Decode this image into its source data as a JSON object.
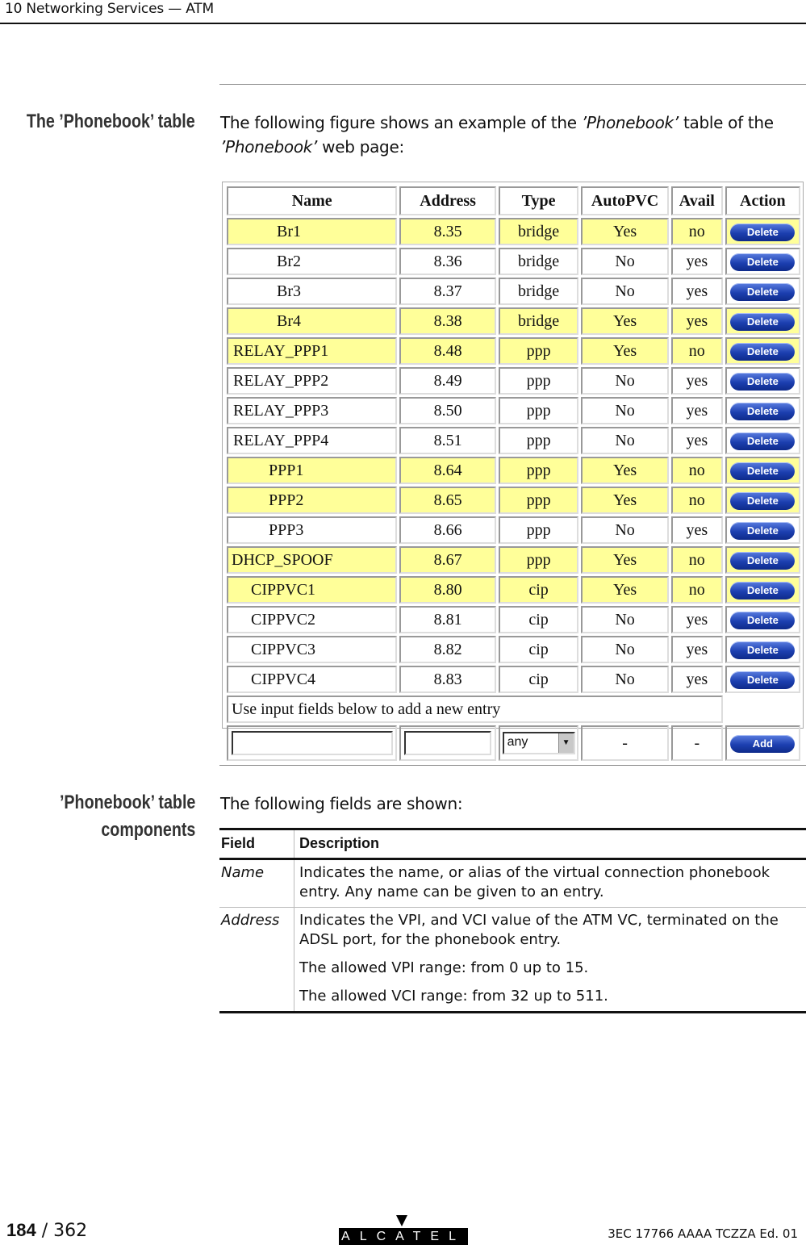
{
  "header": {
    "title": "10 Networking Services — ATM"
  },
  "section1": {
    "side_title": "The ’Phonebook’ table",
    "intro_pre": "The following figure shows an example of the ",
    "intro_em1": "’Phonebook’",
    "intro_mid": " table of the ",
    "intro_em2": "’Phonebook’",
    "intro_post": " web page:"
  },
  "phonebook": {
    "columns": [
      "Name",
      "Address",
      "Type",
      "AutoPVC",
      "Avail",
      "Action"
    ],
    "rows": [
      {
        "name": "Br1",
        "address": "8.35",
        "type": "bridge",
        "autopvc": "Yes",
        "avail": "no",
        "action": "Delete",
        "highlight": true,
        "indent": "br"
      },
      {
        "name": "Br2",
        "address": "8.36",
        "type": "bridge",
        "autopvc": "No",
        "avail": "yes",
        "action": "Delete",
        "highlight": false,
        "indent": "br"
      },
      {
        "name": "Br3",
        "address": "8.37",
        "type": "bridge",
        "autopvc": "No",
        "avail": "yes",
        "action": "Delete",
        "highlight": false,
        "indent": "br"
      },
      {
        "name": "Br4",
        "address": "8.38",
        "type": "bridge",
        "autopvc": "Yes",
        "avail": "yes",
        "action": "Delete",
        "highlight": true,
        "indent": "br"
      },
      {
        "name": "RELAY_PPP1",
        "address": "8.48",
        "type": "ppp",
        "autopvc": "Yes",
        "avail": "no",
        "action": "Delete",
        "highlight": true,
        "indent": "relay"
      },
      {
        "name": "RELAY_PPP2",
        "address": "8.49",
        "type": "ppp",
        "autopvc": "No",
        "avail": "yes",
        "action": "Delete",
        "highlight": false,
        "indent": "relay"
      },
      {
        "name": "RELAY_PPP3",
        "address": "8.50",
        "type": "ppp",
        "autopvc": "No",
        "avail": "yes",
        "action": "Delete",
        "highlight": false,
        "indent": "relay"
      },
      {
        "name": "RELAY_PPP4",
        "address": "8.51",
        "type": "ppp",
        "autopvc": "No",
        "avail": "yes",
        "action": "Delete",
        "highlight": false,
        "indent": "relay"
      },
      {
        "name": "PPP1",
        "address": "8.64",
        "type": "ppp",
        "autopvc": "Yes",
        "avail": "no",
        "action": "Delete",
        "highlight": true,
        "indent": "ppp"
      },
      {
        "name": "PPP2",
        "address": "8.65",
        "type": "ppp",
        "autopvc": "Yes",
        "avail": "no",
        "action": "Delete",
        "highlight": true,
        "indent": "ppp"
      },
      {
        "name": "PPP3",
        "address": "8.66",
        "type": "ppp",
        "autopvc": "No",
        "avail": "yes",
        "action": "Delete",
        "highlight": false,
        "indent": "ppp"
      },
      {
        "name": "DHCP_SPOOF",
        "address": "8.67",
        "type": "ppp",
        "autopvc": "Yes",
        "avail": "no",
        "action": "Delete",
        "highlight": true,
        "indent": "dhcp"
      },
      {
        "name": "CIPPVC1",
        "address": "8.80",
        "type": "cip",
        "autopvc": "Yes",
        "avail": "no",
        "action": "Delete",
        "highlight": true,
        "indent": "cip"
      },
      {
        "name": "CIPPVC2",
        "address": "8.81",
        "type": "cip",
        "autopvc": "No",
        "avail": "yes",
        "action": "Delete",
        "highlight": false,
        "indent": "cip"
      },
      {
        "name": "CIPPVC3",
        "address": "8.82",
        "type": "cip",
        "autopvc": "No",
        "avail": "yes",
        "action": "Delete",
        "highlight": false,
        "indent": "cip"
      },
      {
        "name": "CIPPVC4",
        "address": "8.83",
        "type": "cip",
        "autopvc": "No",
        "avail": "yes",
        "action": "Delete",
        "highlight": false,
        "indent": "cip"
      }
    ],
    "add_note": "Use input fields below to add a new entry",
    "add_row": {
      "name_value": "",
      "address_value": "",
      "type_selected": "any",
      "autopvc": "-",
      "avail": "-",
      "add_label": "Add"
    },
    "highlight_color": "#ffff99",
    "button_color": "#1c3fb0"
  },
  "section2": {
    "side_title_line1": "’Phonebook’ table",
    "side_title_line2": "components",
    "intro": "The following fields are shown:"
  },
  "fields_table": {
    "header": {
      "field": "Field",
      "description": "Description"
    },
    "rows": [
      {
        "field": "Name",
        "paragraphs": [
          "Indicates the name, or alias of the virtual connection phonebook entry. Any name can be given to an entry."
        ]
      },
      {
        "field": "Address",
        "paragraphs": [
          "Indicates the VPI, and VCI value of the ATM VC, terminated on the ADSL port, for the phonebook entry.",
          "The allowed VPI range: from 0 up to 15.",
          "The allowed VCI range: from 32 up to 511."
        ]
      }
    ]
  },
  "footer": {
    "page_current": "184",
    "page_total": "/ 362",
    "logo": "ALCATEL",
    "doc_ref": "3EC 17766 AAAA TCZZA Ed. 01"
  }
}
